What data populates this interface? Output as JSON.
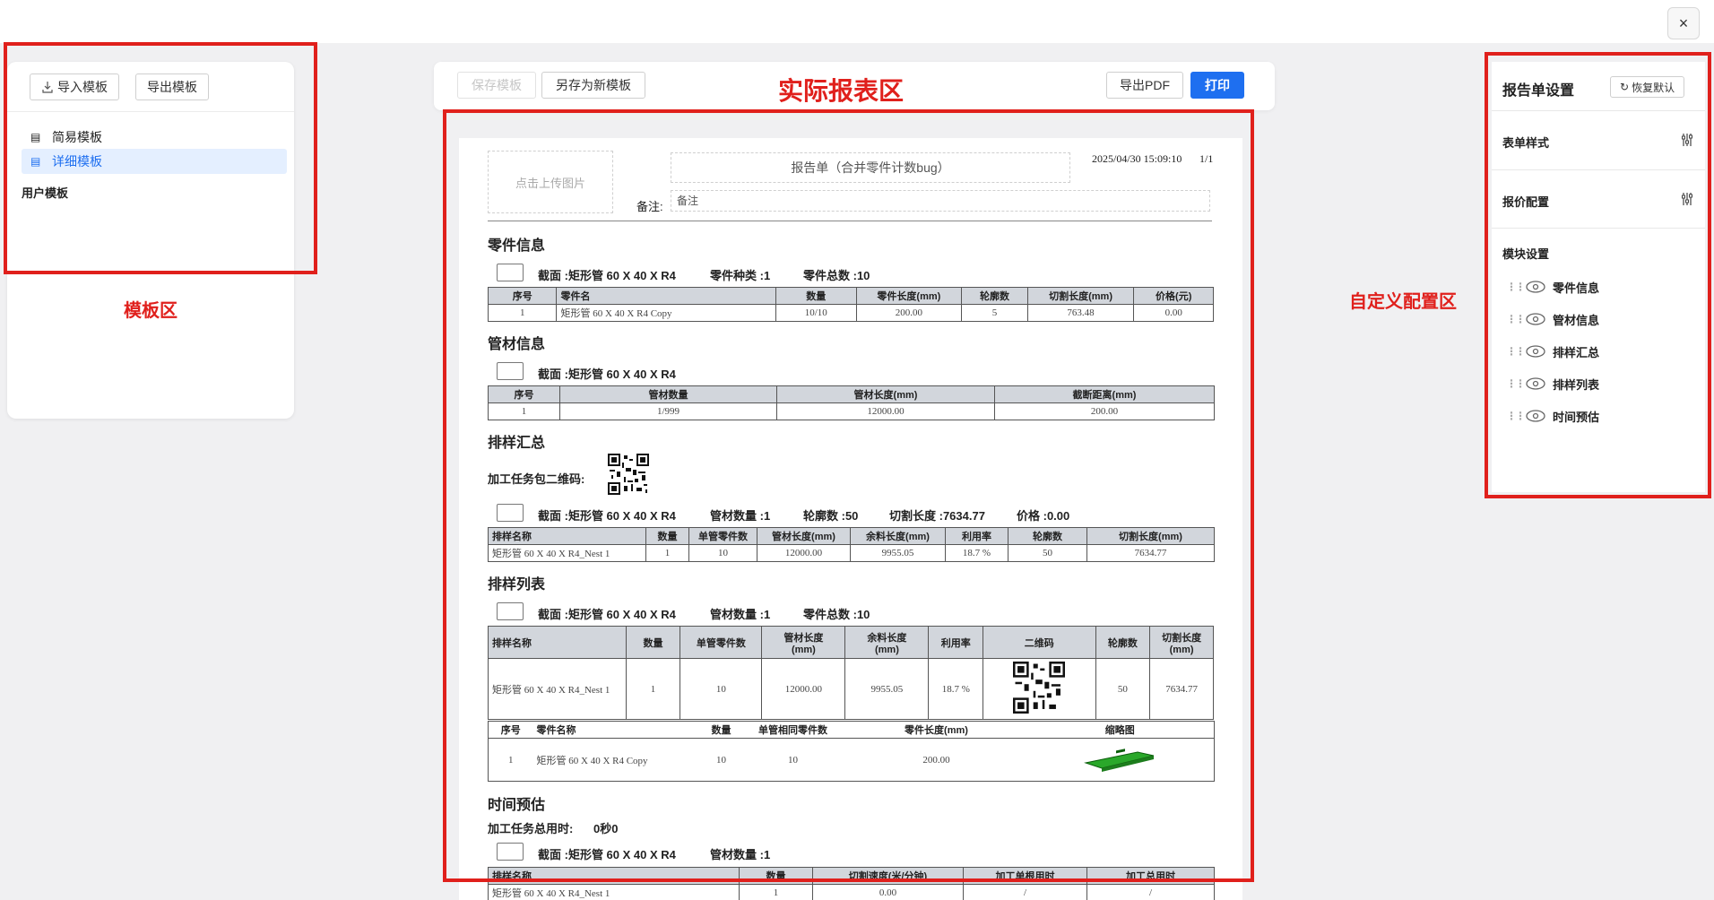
{
  "window": {
    "close_label": "×"
  },
  "annotations": {
    "template_area": "模板区",
    "report_area": "实际报表区",
    "config_area": "自定义配置区"
  },
  "template_panel": {
    "import_label": "导入模板",
    "export_label": "导出模板",
    "items": [
      {
        "label": "简易模板",
        "active": false
      },
      {
        "label": "详细模板",
        "active": true
      }
    ],
    "user_templates_label": "用户模板"
  },
  "report_toolbar": {
    "save_label": "保存模板",
    "save_as_label": "另存为新模板",
    "export_pdf_label": "导出PDF",
    "print_label": "打印"
  },
  "report": {
    "upload_placeholder": "点击上传图片",
    "title": "报告单（合并零件计数bug）",
    "timestamp": "2025/04/30 15:09:10",
    "page": "1/1",
    "remark_label": "备注:",
    "remark_placeholder": "备注",
    "parts": {
      "title": "零件信息",
      "section_line": "截面 :矩形管 60 X 40 X R4",
      "kind_line": "零件种类 :1",
      "total_line": "零件总数 :10",
      "headers": [
        "序号",
        "零件名",
        "数量",
        "零件长度(mm)",
        "轮廓数",
        "切割长度(mm)",
        "价格(元)"
      ],
      "rows": [
        [
          "1",
          "矩形管 60 X 40 X R4 Copy",
          "10/10",
          "200.00",
          "5",
          "763.48",
          "0.00"
        ]
      ]
    },
    "tubes": {
      "title": "管材信息",
      "section_line": "截面 :矩形管 60 X 40 X R4",
      "headers": [
        "序号",
        "管材数量",
        "管材长度(mm)",
        "截断距离(mm)"
      ],
      "rows": [
        [
          "1",
          "1/999",
          "12000.00",
          "200.00"
        ]
      ]
    },
    "nest_summary": {
      "title": "排样汇总",
      "qr_label": "加工任务包二维码:",
      "section_line": "截面 :矩形管 60 X 40 X R4",
      "tube_count_line": "管材数量 :1",
      "contour_line": "轮廓数 :50",
      "cut_len_line": "切割长度 :7634.77",
      "price_line": "价格 :0.00",
      "headers": [
        "排样名称",
        "数量",
        "单管零件数",
        "管材长度(mm)",
        "余料长度(mm)",
        "利用率",
        "轮廓数",
        "切割长度(mm)"
      ],
      "rows": [
        [
          "矩形管 60 X 40 X R4_Nest 1",
          "1",
          "10",
          "12000.00",
          "9955.05",
          "18.7 %",
          "50",
          "7634.77"
        ]
      ]
    },
    "nest_list": {
      "title": "排样列表",
      "section_line": "截面 :矩形管 60 X 40 X R4",
      "tube_count_line": "管材数量 :1",
      "total_line": "零件总数 :10",
      "headers": [
        "排样名称",
        "数量",
        "单管零件数",
        "管材长度\n(mm)",
        "余料长度\n(mm)",
        "利用率",
        "二维码",
        "轮廓数",
        "切割长度\n(mm)"
      ],
      "row": [
        "矩形管 60 X 40 X R4_Nest 1",
        "1",
        "10",
        "12000.00",
        "9955.05",
        "18.7 %",
        "",
        "50",
        "7634.77"
      ],
      "sub_headers": [
        "序号",
        "零件名称",
        "数量",
        "单管相同零件数",
        "零件长度(mm)",
        "缩略图"
      ],
      "sub_row": [
        "1",
        "矩形管 60 X 40 X R4 Copy",
        "10",
        "10",
        "200.00",
        ""
      ]
    },
    "time": {
      "title": "时间预估",
      "total_label": "加工任务总用时:",
      "total_value": "0秒0",
      "section_line": "截面 :矩形管 60 X 40 X R4",
      "tube_count_line": "管材数量 :1",
      "headers": [
        "排样名称",
        "数量",
        "切割速度(米/分钟)",
        "加工单根用时",
        "加工总用时"
      ],
      "rows": [
        [
          "矩形管 60 X 40 X R4_Nest 1",
          "1",
          "0.00",
          "/",
          "/"
        ]
      ]
    }
  },
  "settings_panel": {
    "title": "报告单设置",
    "reset_label": "恢复默认",
    "form_style_label": "表单样式",
    "price_config_label": "报价配置",
    "module_settings_label": "模块设置",
    "modules": [
      "零件信息",
      "管材信息",
      "排样汇总",
      "排样列表",
      "时间预估"
    ]
  },
  "colors": {
    "accent": "#1e6ff0",
    "annotation_red": "#e0201c",
    "table_header_bg": "#d2d6dc"
  }
}
